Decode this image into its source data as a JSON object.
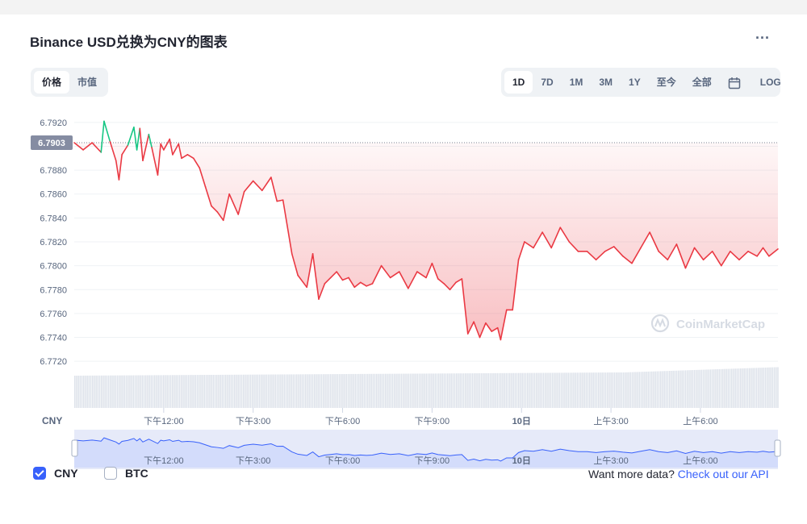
{
  "header": {
    "title": "Binance USD兑换为CNY的图表",
    "more_label": "..."
  },
  "type_tabs": [
    {
      "label": "价格",
      "active": true
    },
    {
      "label": "市值",
      "active": false
    }
  ],
  "range_tabs": [
    {
      "label": "1D",
      "active": true
    },
    {
      "label": "7D"
    },
    {
      "label": "1M"
    },
    {
      "label": "3M"
    },
    {
      "label": "1Y"
    },
    {
      "label": "至今"
    },
    {
      "label": "全部"
    }
  ],
  "log_label": "LOG",
  "icons": {
    "calendar": "calendar-icon",
    "more": "more-dots-icon",
    "watermark": "coinmarketcap-logo-icon"
  },
  "watermark_text": "CoinMarketCap",
  "currency_label": "CNY",
  "colors": {
    "up": "#16c784",
    "down": "#ea3943",
    "accent": "#3861fb",
    "price_tag": "#858ca2"
  },
  "chart_data": {
    "type": "line",
    "title": "Binance USD兑换为CNY的图表",
    "ylabel": "CNY",
    "ylim": [
      6.7712,
      6.7928
    ],
    "y_ticks": [
      "6.7920",
      "6.7900",
      "6.7880",
      "6.7860",
      "6.7840",
      "6.7820",
      "6.7800",
      "6.7780",
      "6.7760",
      "6.7740",
      "6.7720"
    ],
    "x_ticks": [
      "下午12:00",
      "下午3:00",
      "下午6:00",
      "下午9:00",
      "10日",
      "上午3:00",
      "上午6:00"
    ],
    "x_ticks_hours": [
      3,
      6,
      9,
      12,
      15,
      18,
      21
    ],
    "x_range_hours": [
      0,
      23.6
    ],
    "reference_price": 6.7903,
    "reference_label": "6.7903",
    "grid": true,
    "series": [
      {
        "x": [
          0,
          0.3,
          0.6,
          0.9,
          1.0,
          1.2,
          1.4,
          1.5,
          1.6,
          1.8,
          2.0,
          2.1,
          2.2,
          2.3,
          2.5,
          2.6,
          2.8,
          2.9,
          3.0,
          3.2,
          3.3,
          3.5,
          3.6,
          3.8,
          4.0,
          4.2,
          4.4,
          4.6,
          4.8,
          5.0,
          5.2,
          5.5,
          5.7,
          6.0,
          6.3,
          6.6,
          6.8,
          7.0,
          7.3,
          7.5,
          7.8,
          8.0,
          8.2,
          8.4,
          8.6,
          8.8,
          9.0,
          9.2,
          9.4,
          9.6,
          9.8,
          10.0,
          10.3,
          10.6,
          10.9,
          11.2,
          11.5,
          11.8,
          12.0,
          12.2,
          12.4,
          12.6,
          12.8,
          13.0,
          13.2,
          13.4,
          13.6,
          13.8,
          14.0,
          14.2,
          14.3,
          14.5,
          14.7,
          14.9,
          15.1,
          15.4,
          15.7,
          16.0,
          16.3,
          16.6,
          16.9,
          17.2,
          17.5,
          17.8,
          18.1,
          18.4,
          18.7,
          19.0,
          19.3,
          19.6,
          19.9,
          20.2,
          20.5,
          20.8,
          21.1,
          21.4,
          21.7,
          22.0,
          22.3,
          22.6,
          22.9,
          23.1,
          23.3,
          23.6
        ],
        "values": [
          6.7903,
          6.7897,
          6.7903,
          6.7895,
          6.7921,
          6.7904,
          6.7888,
          6.7872,
          6.7893,
          6.7901,
          6.7916,
          6.7897,
          6.7915,
          6.7888,
          6.791,
          6.7899,
          6.7876,
          6.7902,
          6.7897,
          6.7906,
          6.7893,
          6.7902,
          6.789,
          6.7893,
          6.789,
          6.7882,
          6.7866,
          6.785,
          6.7845,
          6.7838,
          6.786,
          6.7843,
          6.7862,
          6.7871,
          6.7863,
          6.7874,
          6.7854,
          6.7855,
          6.781,
          6.7792,
          6.7782,
          6.781,
          6.7772,
          6.7785,
          6.779,
          6.7795,
          6.7788,
          6.779,
          6.7782,
          6.7786,
          6.7783,
          6.7785,
          6.78,
          6.779,
          6.7795,
          6.7781,
          6.7795,
          6.779,
          6.7802,
          6.7789,
          6.7785,
          6.778,
          6.7786,
          6.7789,
          6.7743,
          6.7753,
          6.774,
          6.7752,
          6.7745,
          6.7748,
          6.7738,
          6.7763,
          6.7763,
          6.7805,
          6.782,
          6.7815,
          6.7828,
          6.7815,
          6.7832,
          6.782,
          6.7812,
          6.7812,
          6.7805,
          6.7812,
          6.7816,
          6.7808,
          6.7802,
          6.7815,
          6.7828,
          6.7812,
          6.7805,
          6.7818,
          6.7798,
          6.7815,
          6.7805,
          6.7812,
          6.78,
          6.7812,
          6.7805,
          6.7812,
          6.7808,
          6.7815,
          6.7808,
          6.7814
        ]
      }
    ],
    "volume": "uniform",
    "navigator": {
      "x_ticks": [
        "下午12:00",
        "下午3:00",
        "下午6:00",
        "下午9:00",
        "10日",
        "上午3:00",
        "上午6:00"
      ]
    }
  },
  "footer": {
    "options": [
      {
        "label": "CNY",
        "checked": true
      },
      {
        "label": "BTC",
        "checked": false
      }
    ],
    "api_text": "Want more data?",
    "api_link": "Check out our API"
  }
}
